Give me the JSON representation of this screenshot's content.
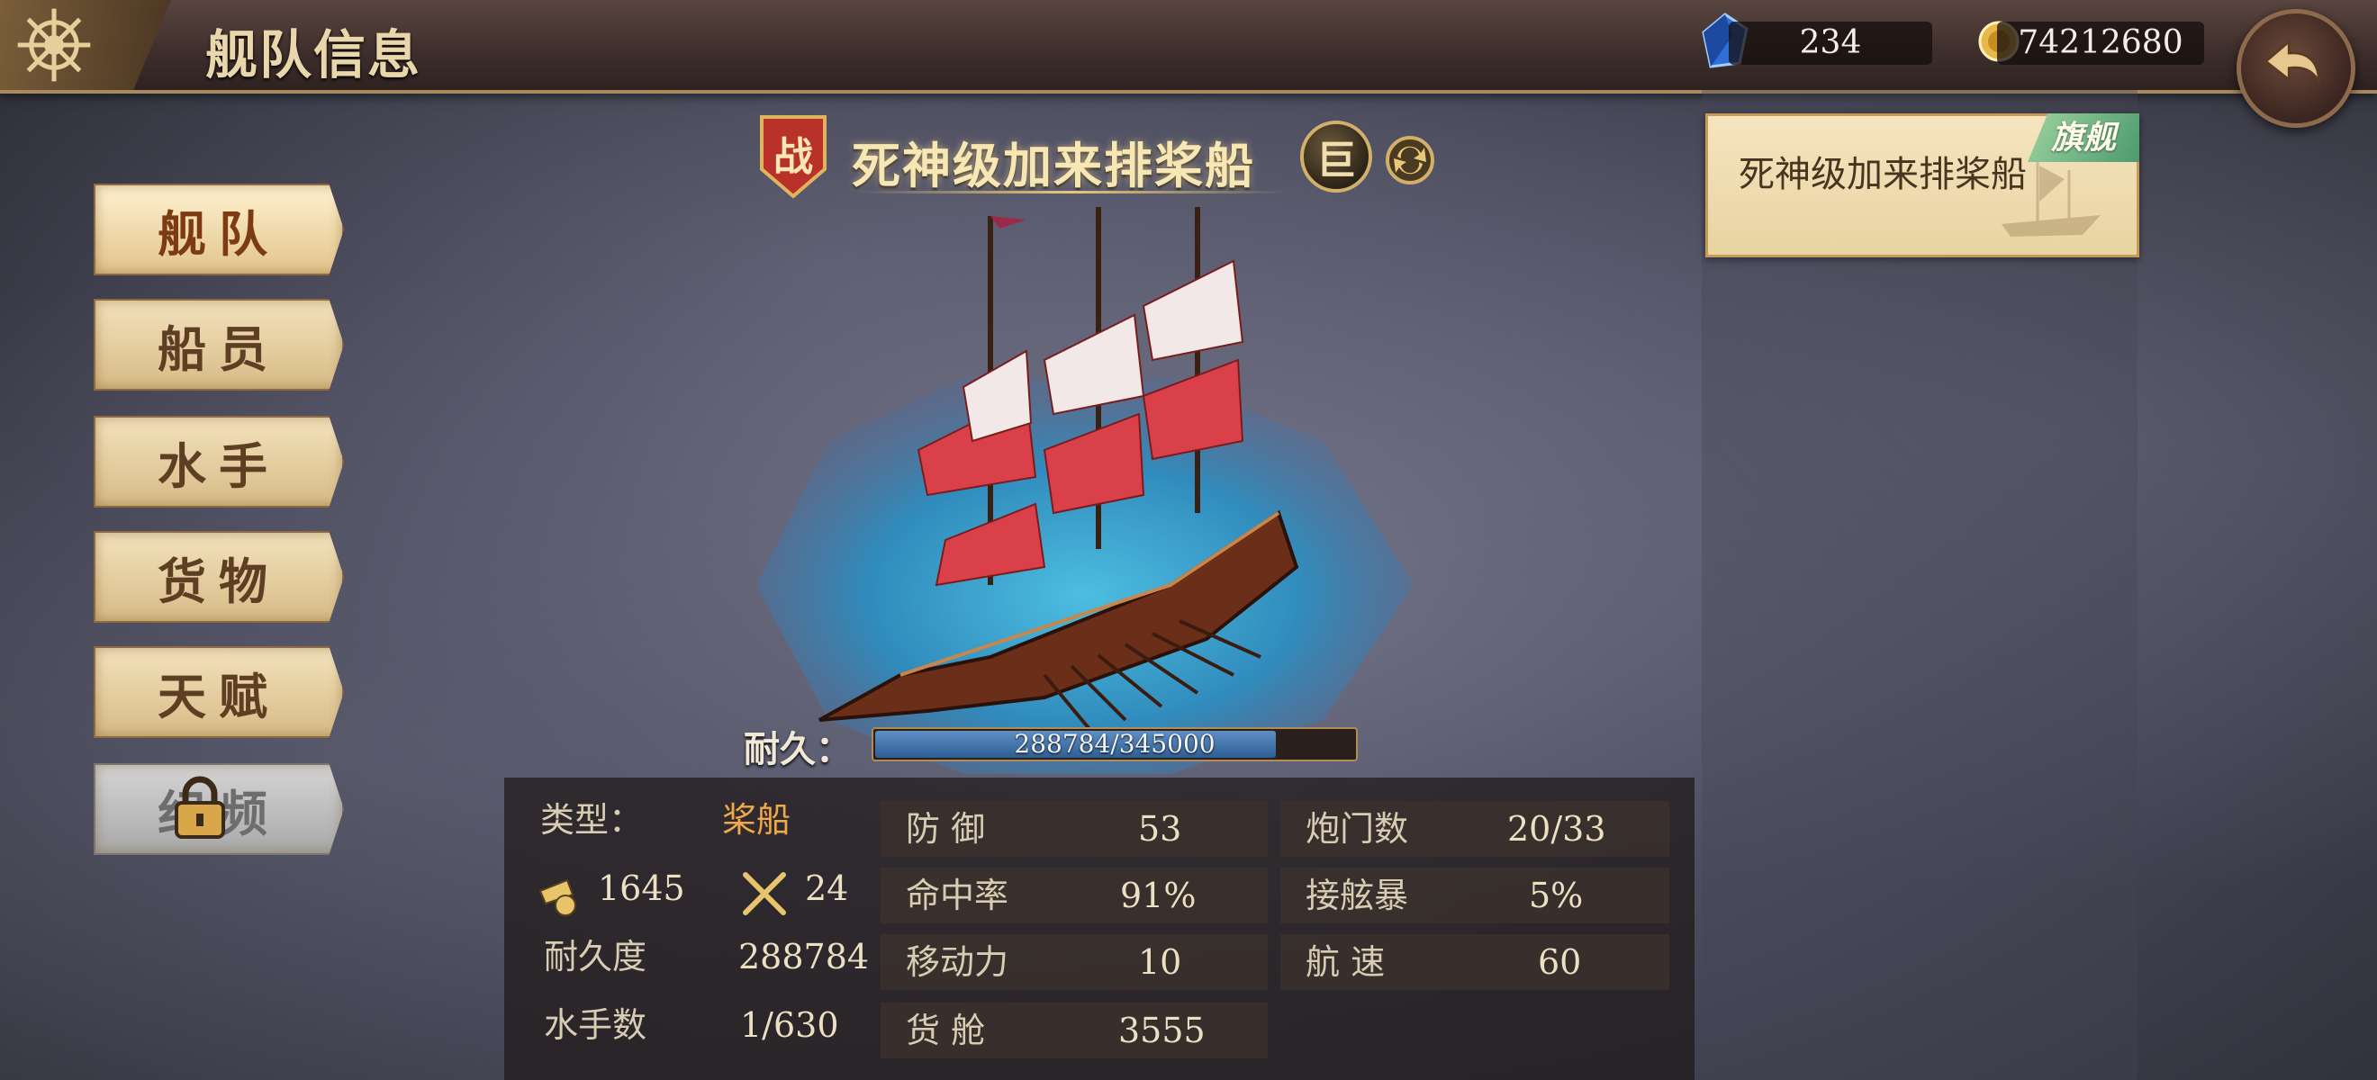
{
  "header": {
    "title": "舰队信息",
    "gems": "234",
    "gold": "74212680"
  },
  "menu": [
    {
      "label": "舰队",
      "state": "active"
    },
    {
      "label": "船员",
      "state": "normal"
    },
    {
      "label": "水手",
      "state": "normal"
    },
    {
      "label": "货物",
      "state": "normal"
    },
    {
      "label": "天赋",
      "state": "normal"
    },
    {
      "label": "纪频",
      "state": "locked"
    }
  ],
  "ship": {
    "badge": "战",
    "name": "死神级加来排桨船",
    "size_badge": "巨",
    "durability_label": "耐久：",
    "durability_text": "288784/345000",
    "durability_fraction": 0.837
  },
  "stats": {
    "type_label": "类型：",
    "type_value": "桨船",
    "cannon_value": "1645",
    "melee_value": "24",
    "durability_label": "耐久度",
    "durability_value": "288784",
    "sailors_label": "水手数",
    "sailors_value": "1/630",
    "defense_label": "防  御",
    "defense_value": "53",
    "hit_label": "命中率",
    "hit_value": "91%",
    "mobility_label": "移动力",
    "mobility_value": "10",
    "hold_label": "货  舱",
    "hold_value": "3555",
    "gunports_label": "炮门数",
    "gunports_value": "20/33",
    "boarding_label": "接舷暴",
    "boarding_value": "5%",
    "speed_label": "航  速",
    "speed_value": "60"
  },
  "flagship": {
    "ribbon": "旗舰",
    "name": "死神级加来排桨船"
  },
  "colors": {
    "accent_gold": "#e6c878",
    "stat_orange": "#f0a84a",
    "durability_blue": "#2d5e94",
    "flag_green": "#4c9a6e"
  },
  "icons": [
    "ship-wheel-icon",
    "blue-gem-icon",
    "gold-coin-icon",
    "back-arrow-icon",
    "lock-icon",
    "swap-icon",
    "cannon-icon",
    "crossed-swords-icon"
  ]
}
